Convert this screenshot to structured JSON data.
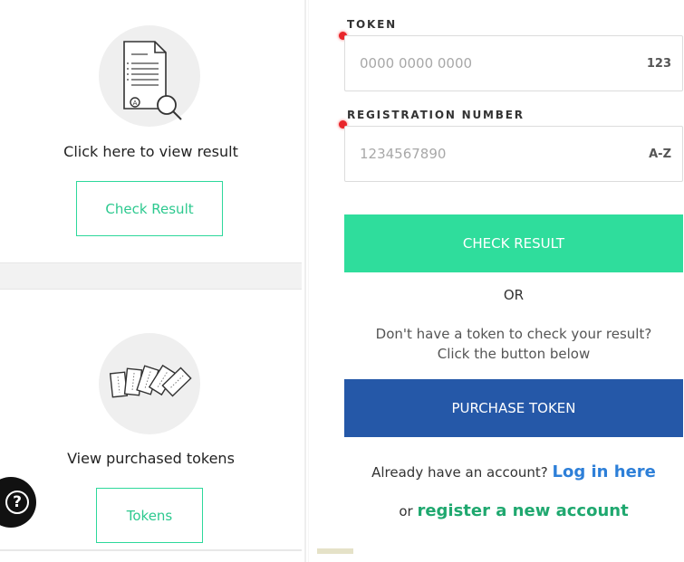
{
  "left": {
    "view_result": {
      "icon": "document-search-icon",
      "text": "Click here to view result",
      "button_label": "Check Result"
    },
    "tokens": {
      "icon": "tickets-icon",
      "text": "View purchased tokens",
      "button_label": "Tokens"
    },
    "help_icon": "question-mark-icon",
    "help_glyph": "?"
  },
  "form": {
    "token": {
      "label": "TOKEN",
      "placeholder": "0000 0000 0000",
      "suffix": "123"
    },
    "registration": {
      "label": "REGISTRATION NUMBER",
      "placeholder": "1234567890",
      "suffix": "A-Z"
    },
    "check_button": "CHECK RESULT",
    "or_text": "OR",
    "info_line1": "Don't have a token to check your result?",
    "info_line2": "Click the button below",
    "purchase_button": "PURCHASE TOKEN",
    "account_prefix": "Already have an account?",
    "login_link": "Log in here",
    "register_prefix": "or",
    "register_link": "register a new account"
  },
  "colors": {
    "accent_green": "#2fdd9c",
    "primary_blue": "#2558a8",
    "link_blue": "#2d7fd8",
    "link_green": "#1fa86f",
    "required_red": "#e8262b"
  }
}
